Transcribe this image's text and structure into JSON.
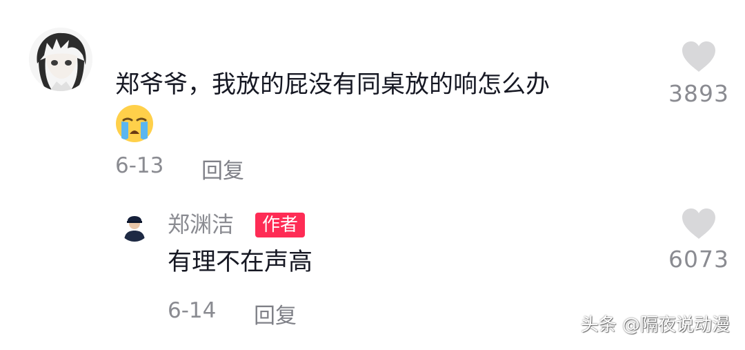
{
  "comment": {
    "text": "郑爷爷，我放的屁没有同桌放的响怎么办",
    "emoji_icon": "loudly-crying-face-icon",
    "date": "6-13",
    "reply_label": "回复",
    "likes": "3893"
  },
  "author_reply": {
    "name": "郑渊洁",
    "badge": "作者",
    "text": "有理不在声高",
    "date": "6-14",
    "reply_label": "回复",
    "likes": "6073"
  },
  "watermark": "头条 @隔夜说动漫",
  "colors": {
    "text_primary": "#161823",
    "text_secondary": "#8a8b91",
    "badge": "#fe2c55",
    "heart": "#d8d8da"
  }
}
